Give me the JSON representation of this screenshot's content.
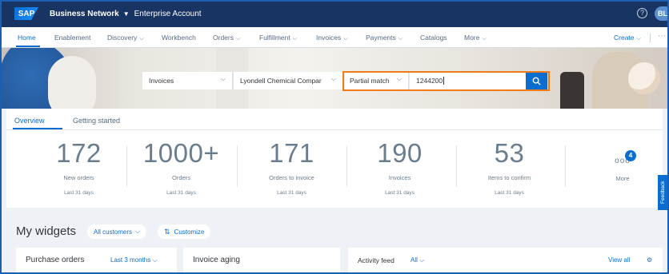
{
  "shell": {
    "logo": "SAP",
    "product": "Business Network",
    "account": "Enterprise Account",
    "help_icon": "help-icon",
    "avatar_initials": "BL"
  },
  "nav": {
    "items": [
      {
        "label": "Home"
      },
      {
        "label": "Enablement"
      },
      {
        "label": "Discovery"
      },
      {
        "label": "Workbench"
      },
      {
        "label": "Orders"
      },
      {
        "label": "Fulfillment"
      },
      {
        "label": "Invoices"
      },
      {
        "label": "Payments"
      },
      {
        "label": "Catalogs"
      },
      {
        "label": "More"
      }
    ],
    "create_label": "Create"
  },
  "search": {
    "type": "Invoices",
    "customer": "Lyondell Chemical Compar",
    "match": "Partial match",
    "query": "1244200"
  },
  "overview": {
    "tabs": [
      "Overview",
      "Getting started"
    ],
    "kpis": [
      {
        "value": "172",
        "label": "New orders",
        "period": "Last 31 days"
      },
      {
        "value": "1000+",
        "label": "Orders",
        "period": "Last 31 days"
      },
      {
        "value": "171",
        "label": "Orders to invoice",
        "period": "Last 31 days"
      },
      {
        "value": "190",
        "label": "Invoices",
        "period": "Last 31 days"
      },
      {
        "value": "53",
        "label": "Items to confirm",
        "period": "Last 31 days"
      }
    ],
    "more": {
      "label": "More",
      "badge": "4",
      "dots": "ooo"
    }
  },
  "feedback_label": "Feedback",
  "widgets": {
    "title": "My widgets",
    "customers_filter": "All customers",
    "customize": "Customize",
    "cards": [
      {
        "title": "Purchase orders",
        "filter": "Last 3 months"
      },
      {
        "title": "Invoice aging"
      },
      {
        "title": "Activity feed",
        "filter": "All",
        "view_all": "View all"
      }
    ]
  },
  "colors": {
    "shell": "#183463",
    "accent": "#0a6ed1",
    "highlight": "#f07b19"
  }
}
